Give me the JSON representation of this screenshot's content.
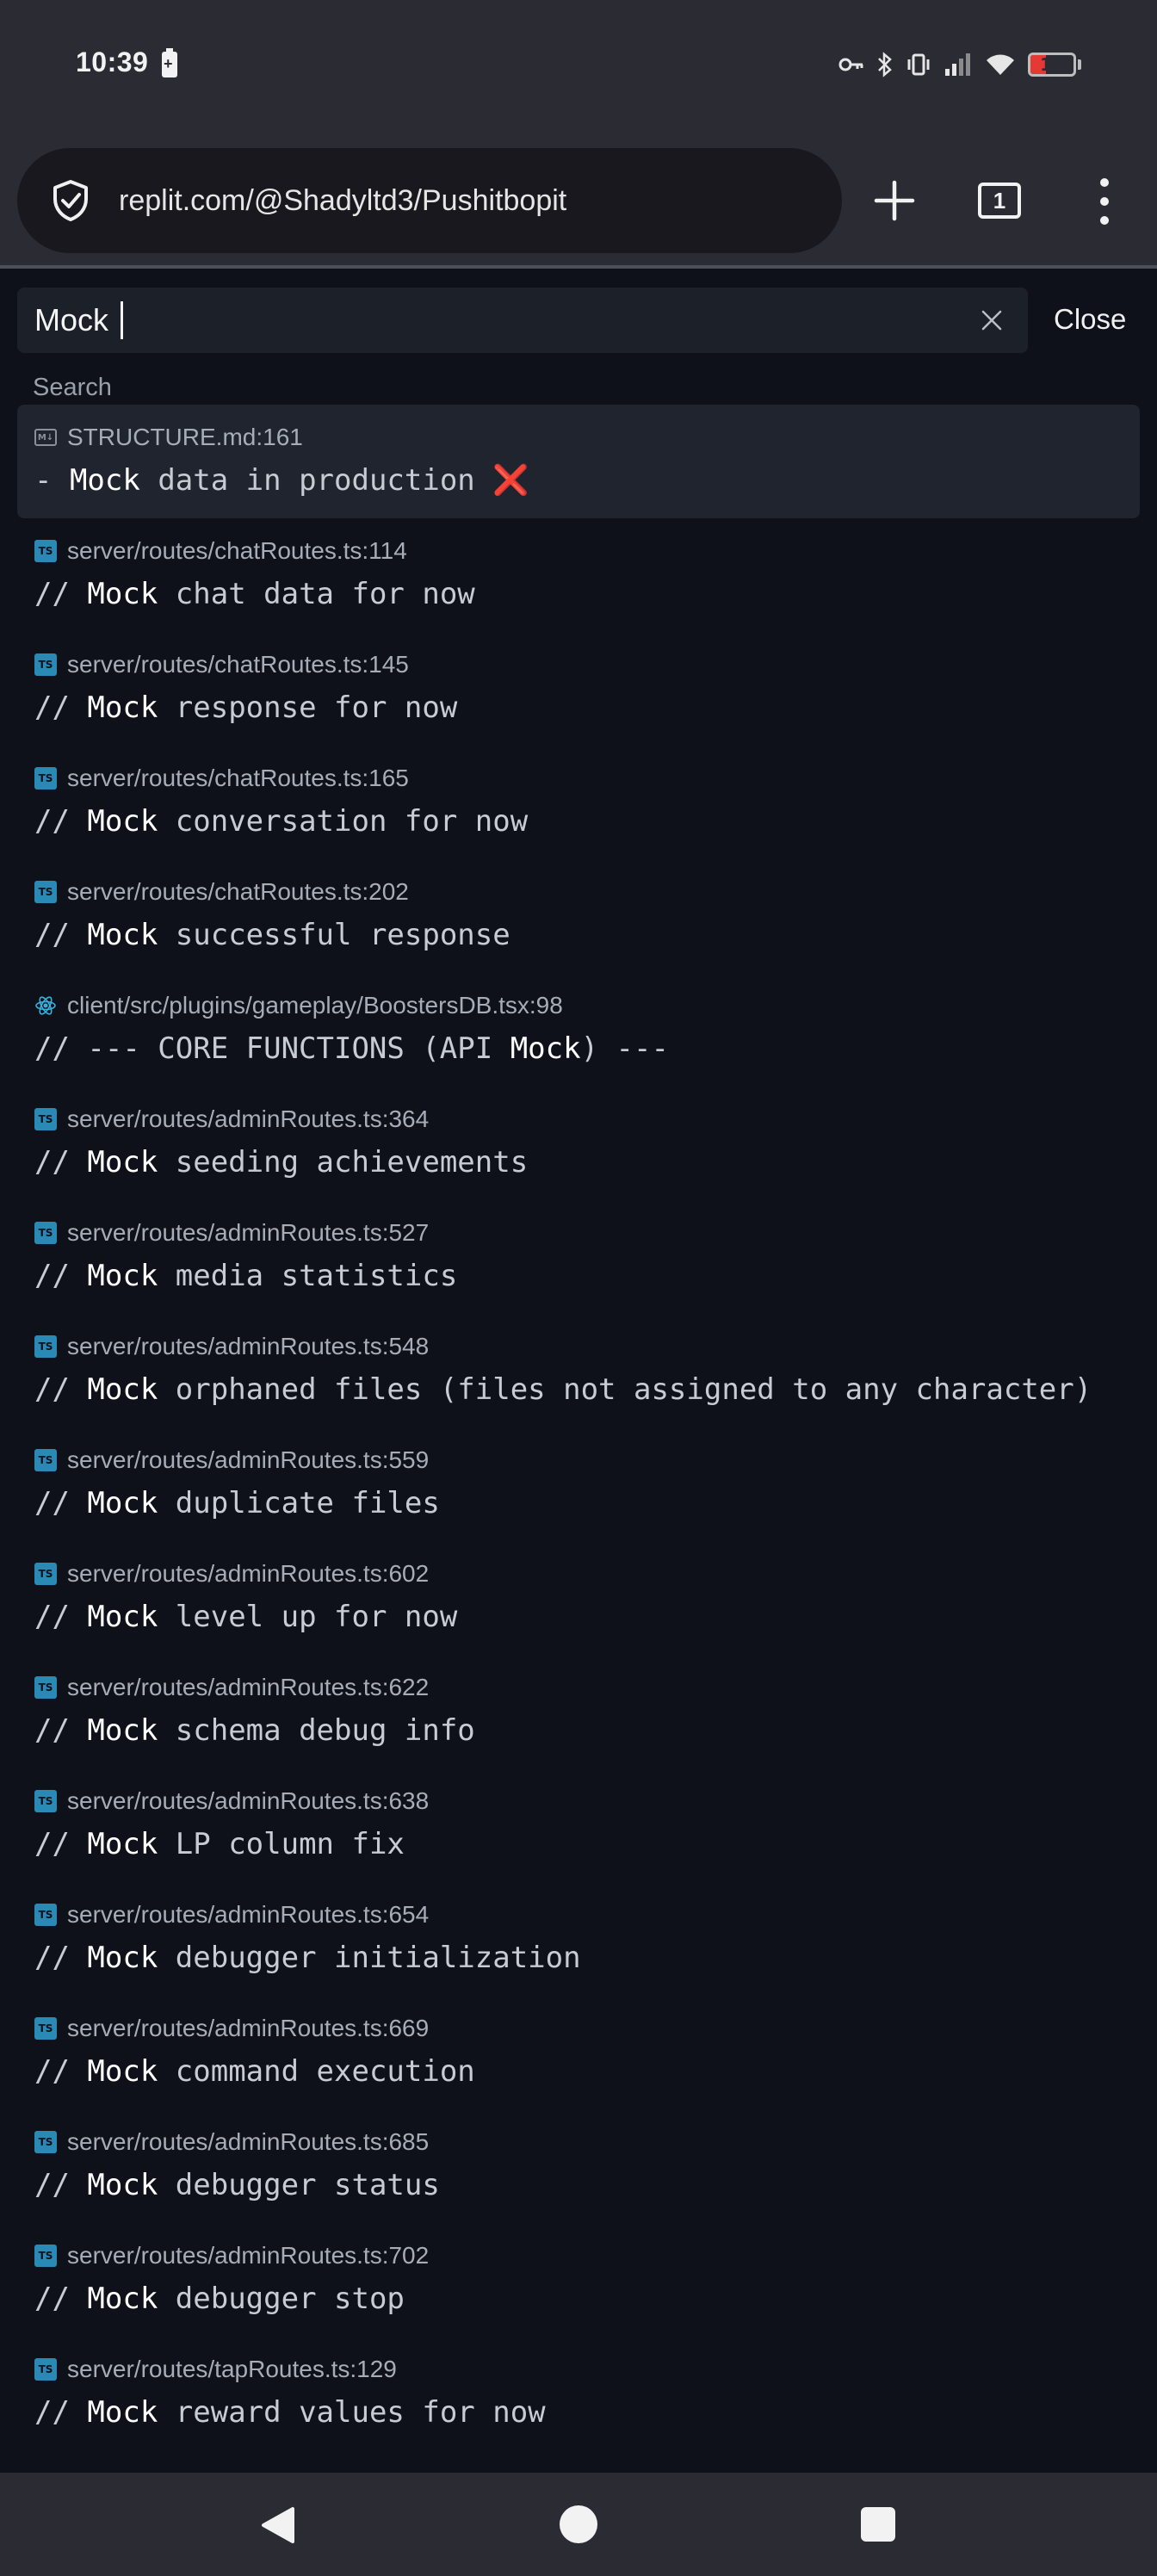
{
  "status_bar": {
    "time": "10:39",
    "battery_level": "18",
    "icons": [
      "battery-saver-icon",
      "vpn-key-icon",
      "bluetooth-icon",
      "vibrate-icon",
      "signal-icon",
      "wifi-icon",
      "battery-icon"
    ]
  },
  "browser": {
    "url": "replit.com/@Shadyltd3/Pushitbopit",
    "tab_count": "1"
  },
  "search": {
    "query": "Mock",
    "close_label": "Close",
    "section_label": "Search"
  },
  "results": [
    {
      "icon": "md",
      "path": "STRUCTURE.md:161",
      "prefix": "- ",
      "match": "Mock",
      "rest": " data in production ",
      "emoji": "❌",
      "selected": true
    },
    {
      "icon": "ts",
      "path": "server/routes/chatRoutes.ts:114",
      "prefix": "// ",
      "match": "Mock",
      "rest": " chat data for now"
    },
    {
      "icon": "ts",
      "path": "server/routes/chatRoutes.ts:145",
      "prefix": "// ",
      "match": "Mock",
      "rest": " response for now"
    },
    {
      "icon": "ts",
      "path": "server/routes/chatRoutes.ts:165",
      "prefix": "// ",
      "match": "Mock",
      "rest": " conversation for now"
    },
    {
      "icon": "ts",
      "path": "server/routes/chatRoutes.ts:202",
      "prefix": "// ",
      "match": "Mock",
      "rest": " successful response"
    },
    {
      "icon": "react",
      "path": "client/src/plugins/gameplay/BoostersDB.tsx:98",
      "prefix": "// --- CORE FUNCTIONS (API ",
      "match": "Mock",
      "rest": ") ---"
    },
    {
      "icon": "ts",
      "path": "server/routes/adminRoutes.ts:364",
      "prefix": "// ",
      "match": "Mock",
      "rest": " seeding achievements"
    },
    {
      "icon": "ts",
      "path": "server/routes/adminRoutes.ts:527",
      "prefix": "// ",
      "match": "Mock",
      "rest": " media statistics"
    },
    {
      "icon": "ts",
      "path": "server/routes/adminRoutes.ts:548",
      "prefix": "// ",
      "match": "Mock",
      "rest": " orphaned files (files not assigned to any character)"
    },
    {
      "icon": "ts",
      "path": "server/routes/adminRoutes.ts:559",
      "prefix": "// ",
      "match": "Mock",
      "rest": " duplicate files"
    },
    {
      "icon": "ts",
      "path": "server/routes/adminRoutes.ts:602",
      "prefix": "// ",
      "match": "Mock",
      "rest": " level up for now"
    },
    {
      "icon": "ts",
      "path": "server/routes/adminRoutes.ts:622",
      "prefix": "// ",
      "match": "Mock",
      "rest": " schema debug info"
    },
    {
      "icon": "ts",
      "path": "server/routes/adminRoutes.ts:638",
      "prefix": "// ",
      "match": "Mock",
      "rest": " LP column fix"
    },
    {
      "icon": "ts",
      "path": "server/routes/adminRoutes.ts:654",
      "prefix": "// ",
      "match": "Mock",
      "rest": " debugger initialization"
    },
    {
      "icon": "ts",
      "path": "server/routes/adminRoutes.ts:669",
      "prefix": "// ",
      "match": "Mock",
      "rest": " command execution"
    },
    {
      "icon": "ts",
      "path": "server/routes/adminRoutes.ts:685",
      "prefix": "// ",
      "match": "Mock",
      "rest": " debugger status"
    },
    {
      "icon": "ts",
      "path": "server/routes/adminRoutes.ts:702",
      "prefix": "// ",
      "match": "Mock",
      "rest": " debugger stop"
    },
    {
      "icon": "ts",
      "path": "server/routes/tapRoutes.ts:129",
      "prefix": "// ",
      "match": "Mock",
      "rest": " reward values for now"
    }
  ],
  "nav_bar": {
    "icons": [
      "back-icon",
      "home-icon",
      "recents-icon"
    ]
  }
}
